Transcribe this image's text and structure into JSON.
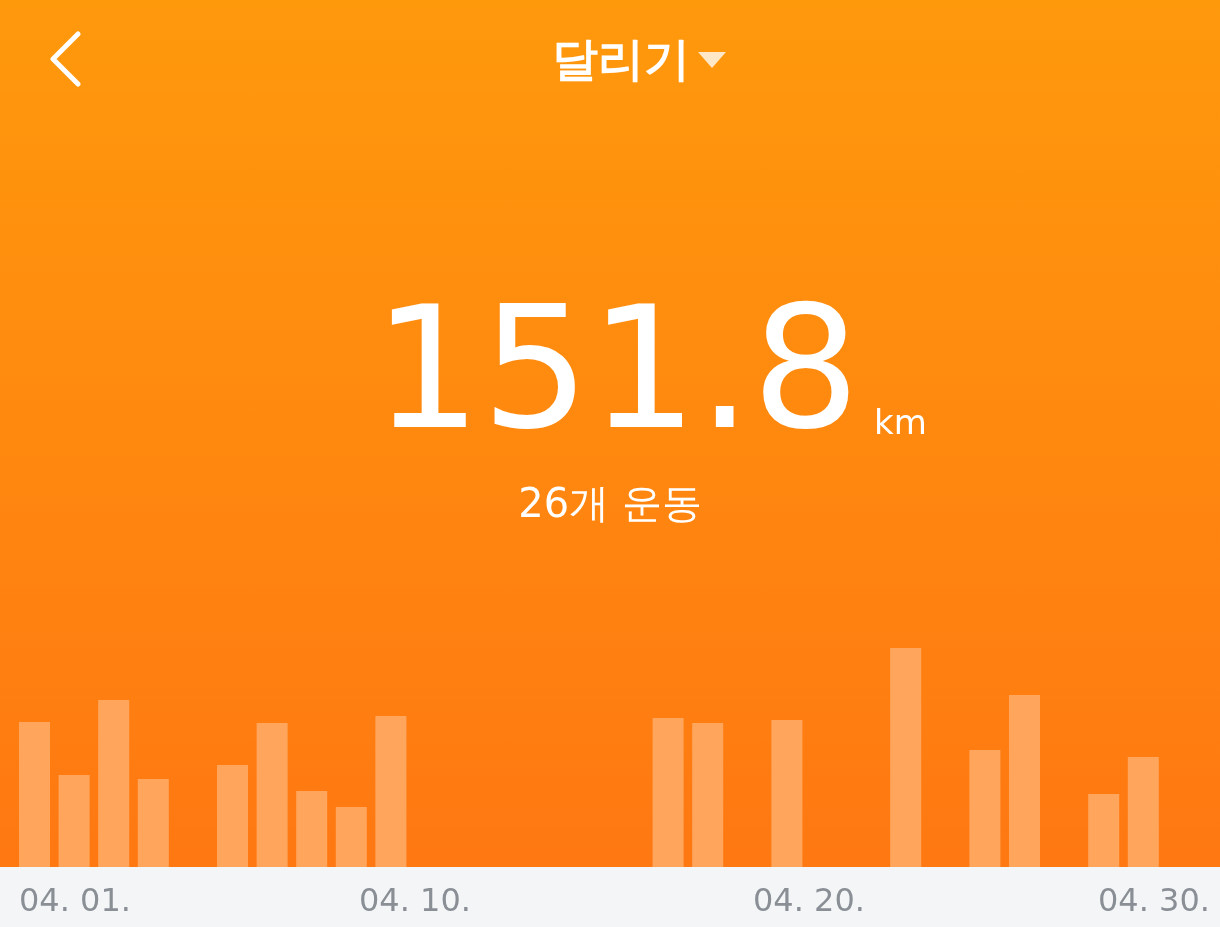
{
  "header": {
    "title": "달리기"
  },
  "summary": {
    "distance": "151.8",
    "unit": "km",
    "workouts": "26개 운동"
  },
  "axis_labels": [
    "04. 01.",
    "04. 10.",
    "04. 20.",
    "04. 30."
  ]
}
